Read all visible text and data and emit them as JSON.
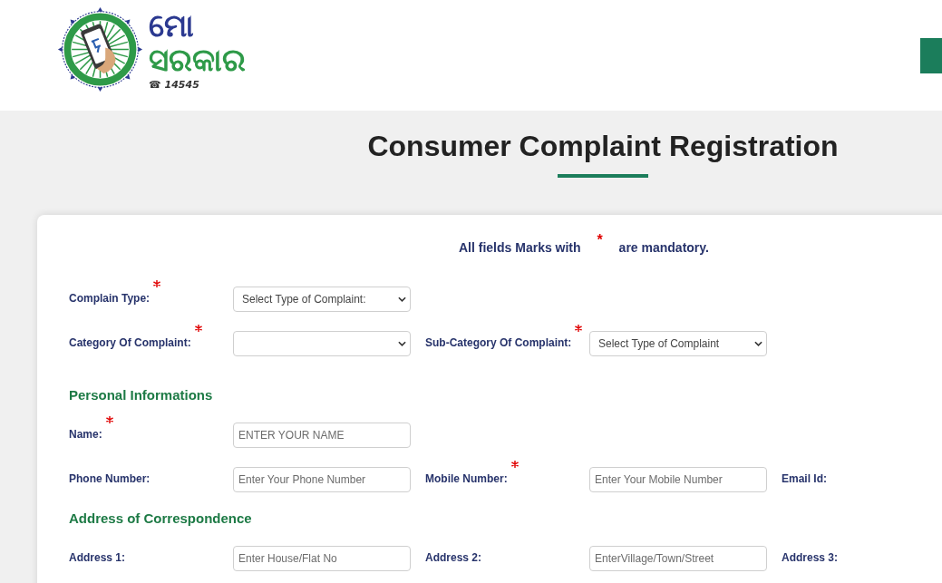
{
  "header": {
    "logo": {
      "title_top": "ମୋ",
      "title_bottom": "ସରକାର",
      "helpline": "☎ 14545"
    }
  },
  "page_title": "Consumer Complaint Registration",
  "form": {
    "mandatory_note": "All fields Marks with $^{*}$ are mandatory.",
    "sections": [
      {
        "rows": [
          {
            "fields": [
              {
                "label": "Complain Type:",
                "required": true,
                "kind": "select",
                "value": "Select Type of Complaint:"
              }
            ]
          },
          {
            "fields": [
              {
                "label": "Category Of Complaint:",
                "required": true,
                "kind": "select"
              },
              {
                "label": "Sub-Category Of Complaint:",
                "required": true,
                "kind": "select",
                "value": "Select Type of Complaint"
              }
            ]
          }
        ]
      },
      {
        "heading": "Personal Informations",
        "rows": [
          {
            "fields": [
              {
                "label": "Name:",
                "required": true,
                "kind": "input",
                "placeholder": "ENTER YOUR NAME"
              }
            ]
          },
          {
            "fields": [
              {
                "label": "Phone Number:",
                "required": false,
                "kind": "input",
                "placeholder": "Enter Your Phone Number"
              },
              {
                "label": "Mobile Number:",
                "required": true,
                "kind": "input",
                "placeholder": "Enter Your Mobile Number"
              },
              {
                "label": "Email Id:",
                "required": false
              }
            ]
          }
        ]
      },
      {
        "heading": "Address of Correspondence",
        "rows": [
          {
            "fields": [
              {
                "label": "Address 1:",
                "required": false,
                "kind": "input",
                "placeholder": "Enter House/Flat No"
              },
              {
                "label": "Address 2:",
                "required": false,
                "kind": "input",
                "placeholder": "EnterVillage/Town/Street"
              },
              {
                "label": "Address 3:",
                "required": false
              }
            ]
          }
        ]
      }
    ]
  }
}
